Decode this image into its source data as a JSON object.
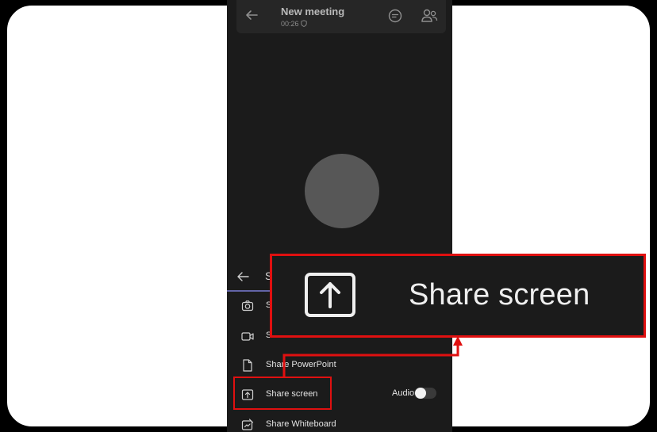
{
  "meeting": {
    "title": "New meeting",
    "elapsed": "00:26"
  },
  "share_panel": {
    "title_fragment": "S",
    "items": [
      {
        "label": "S",
        "icon": "camera-icon"
      },
      {
        "label": "Share video",
        "icon": "video-icon"
      },
      {
        "label": "Share PowerPoint",
        "icon": "document-icon"
      },
      {
        "label": "Share screen",
        "icon": "share-screen-icon"
      },
      {
        "label": "Share Whiteboard",
        "icon": "whiteboard-icon"
      }
    ],
    "audio_label": "Audio",
    "audio_enabled": true
  },
  "callout": {
    "label": "Share screen",
    "icon": "share-screen-icon"
  },
  "colors": {
    "highlight": "#e01010",
    "background": "#1b1b1b",
    "accent": "#6264a7"
  }
}
